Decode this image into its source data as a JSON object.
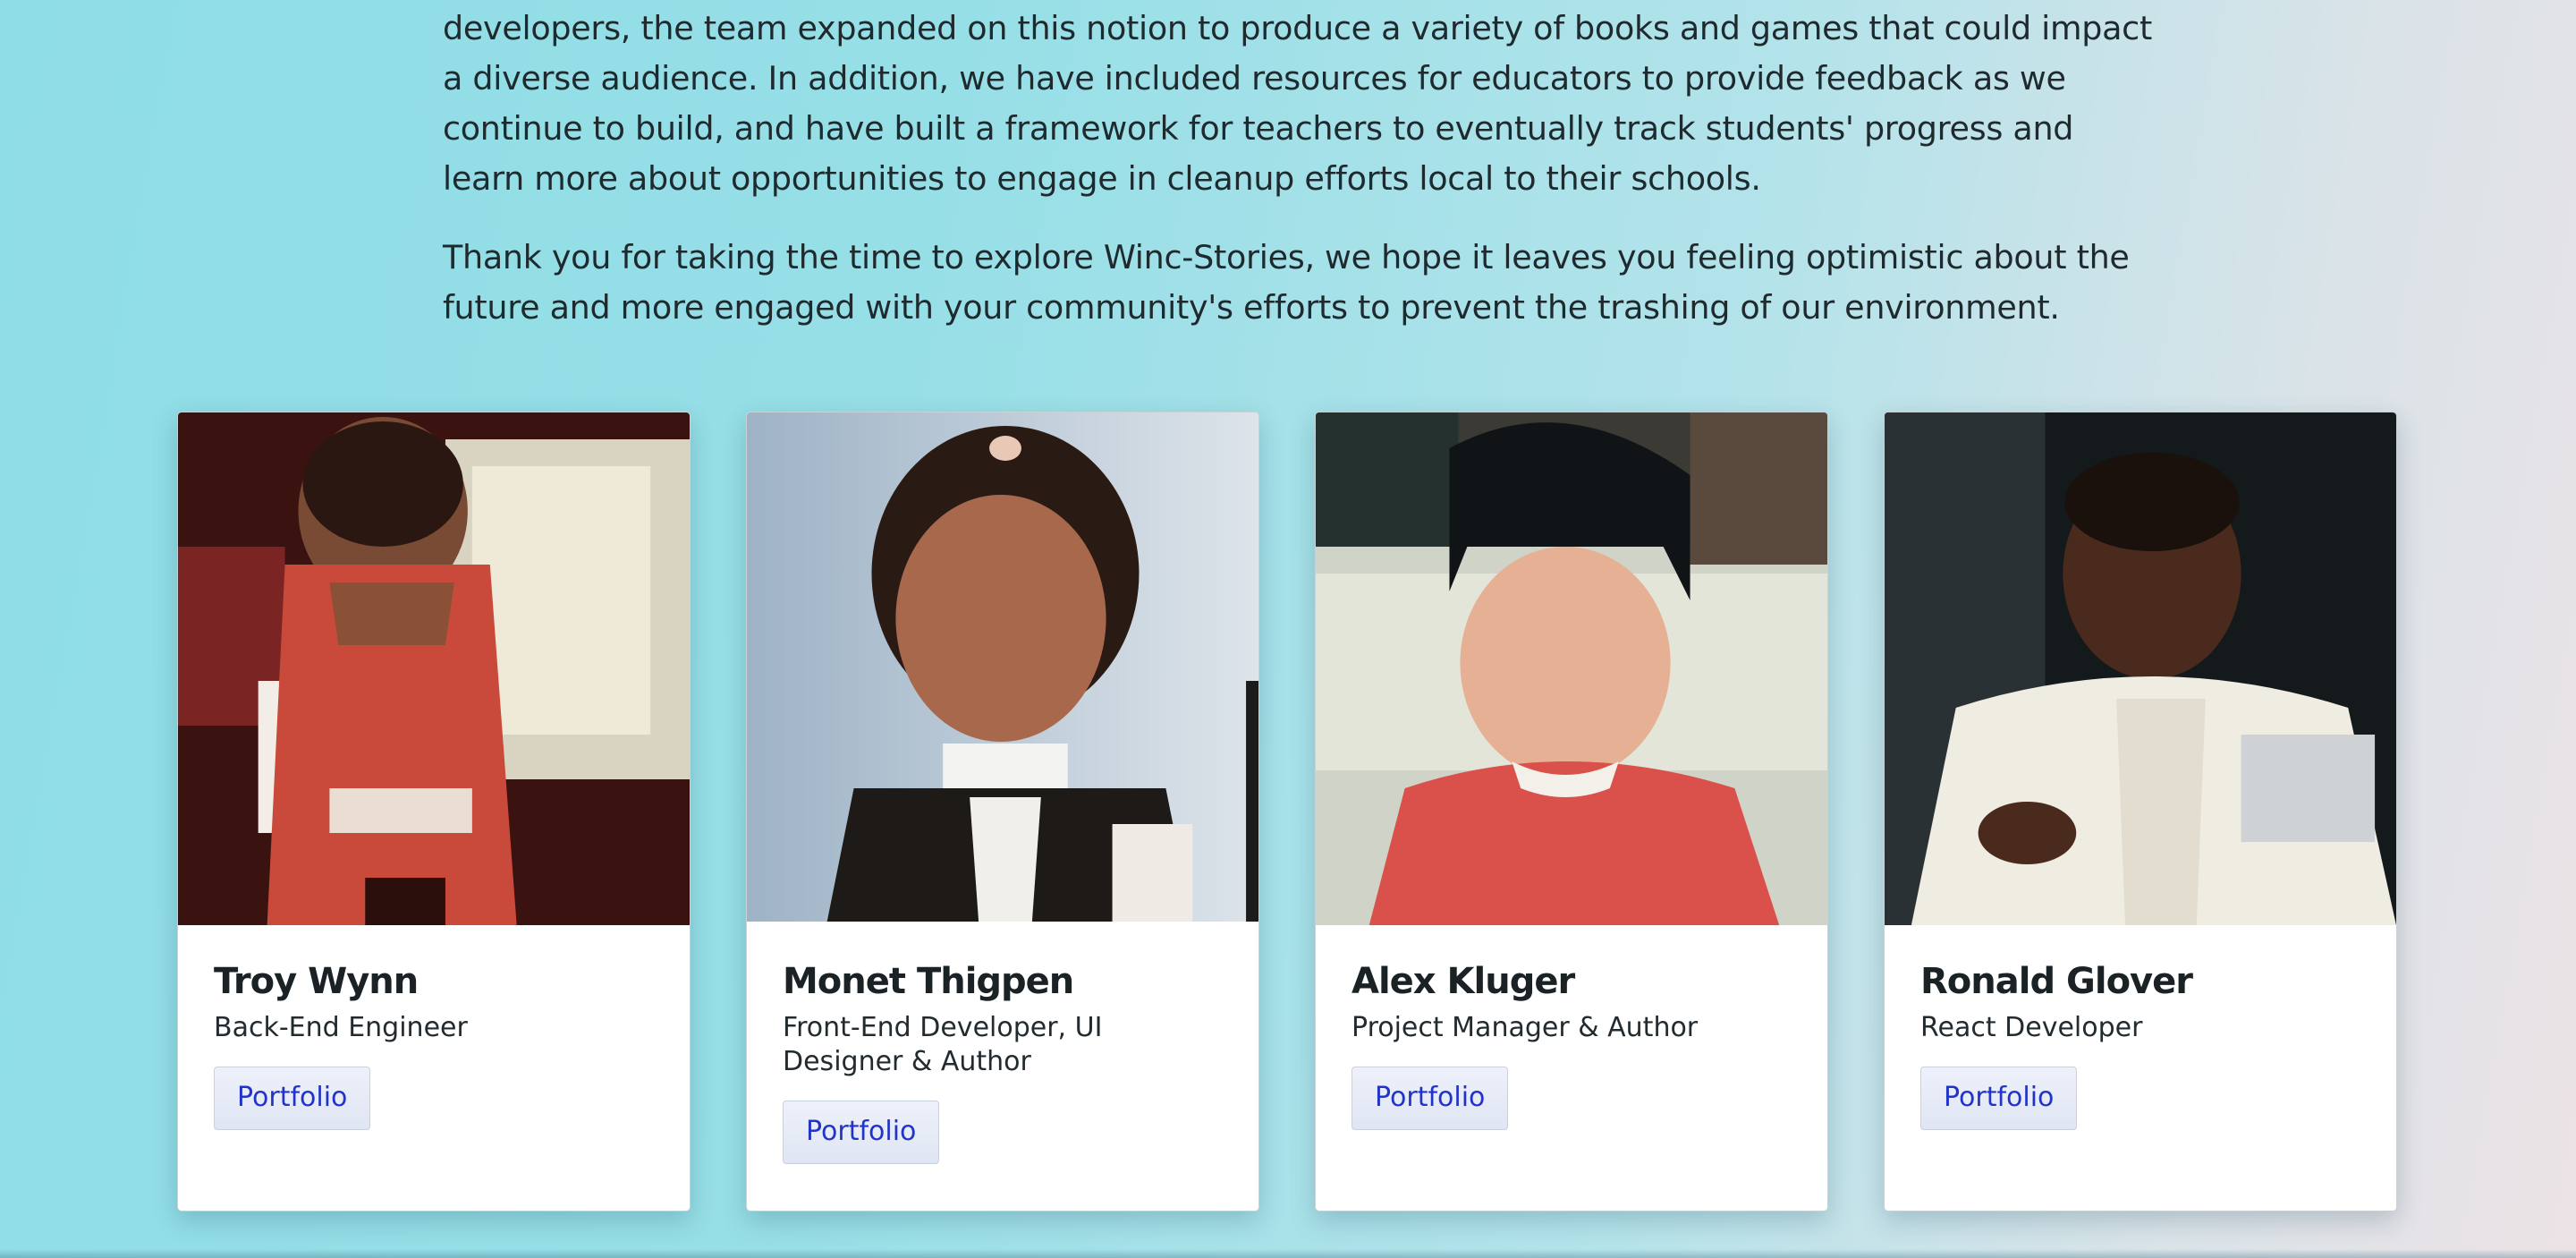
{
  "intro": {
    "paragraph1": "developers, the team expanded on this notion to produce a variety of books and games that could impact a diverse audience. In addition, we have included resources for educators to provide feedback as we continue to build, and have built a framework for teachers to eventually track students' progress and learn more about opportunities to engage in cleanup efforts local to their schools.",
    "paragraph2": "Thank you for taking the time to explore Winc-Stories, we hope it leaves you feeling optimistic about the future and more engaged with your community's efforts to prevent the trashing of our environment."
  },
  "team": [
    {
      "name": "Troy Wynn",
      "role": "Back-End Engineer",
      "button": "Portfolio",
      "photo_icon": "child-photo"
    },
    {
      "name": "Monet Thigpen",
      "role": "Front-End Developer, UI Designer & Author",
      "button": "Portfolio",
      "photo_icon": "child-photo"
    },
    {
      "name": "Alex Kluger",
      "role": "Project Manager & Author",
      "button": "Portfolio",
      "photo_icon": "child-photo"
    },
    {
      "name": "Ronald Glover",
      "role": "React Developer",
      "button": "Portfolio",
      "photo_icon": "child-photo"
    }
  ],
  "colors": {
    "button_text": "#2234c8",
    "background_start": "#8fdde6",
    "background_end": "#ece3e6"
  }
}
